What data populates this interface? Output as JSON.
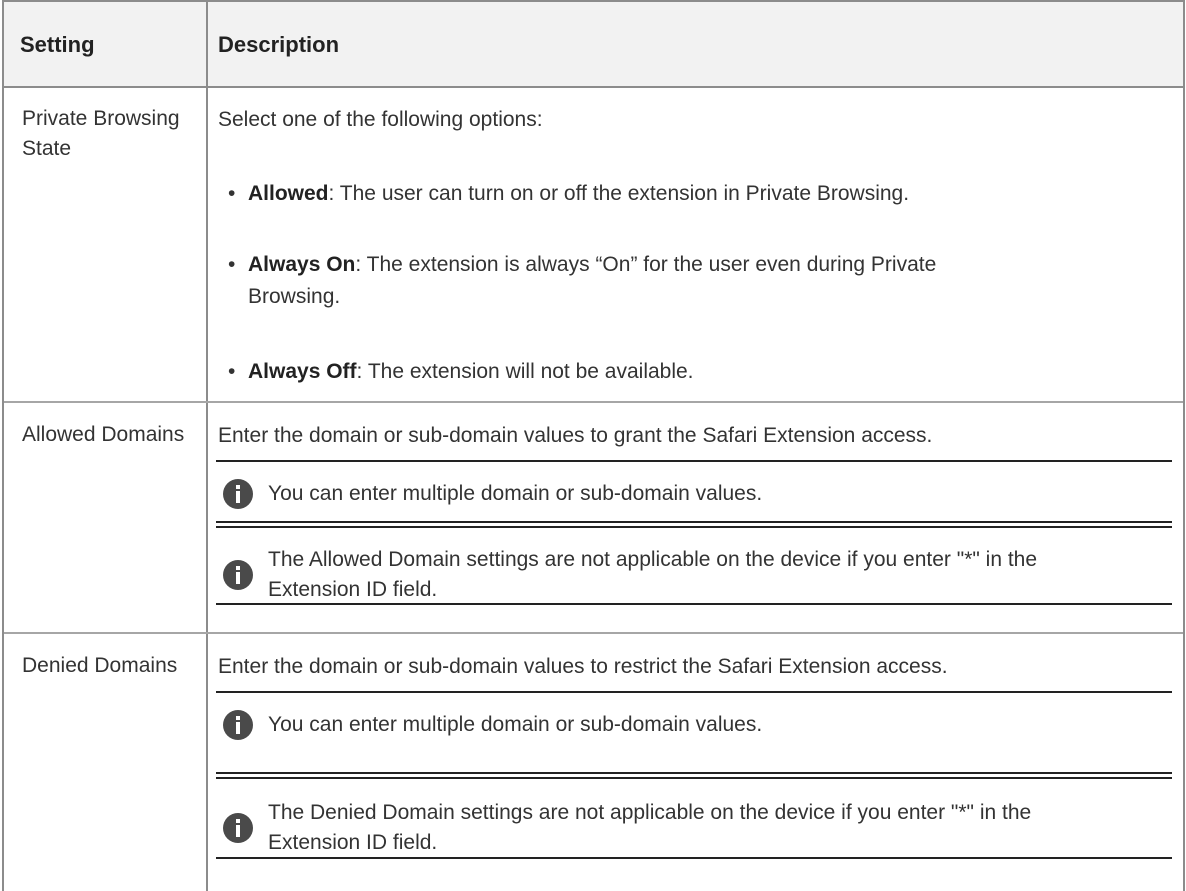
{
  "header": {
    "col1": "Setting",
    "col2": "Description"
  },
  "rows": [
    {
      "setting": "Private Browsing State",
      "intro": "Select one of the following options:",
      "options": [
        {
          "term": "Allowed",
          "desc": ": The user can turn on or off the extension in Private Browsing."
        },
        {
          "term": "Always On",
          "desc": ": The extension is always “On” for the user even during Private Browsing."
        },
        {
          "term": "Always Off",
          "desc": ": The extension will not be available."
        }
      ]
    },
    {
      "setting": "Allowed Domains",
      "intro": "Enter the domain or sub-domain values to grant the Safari Extension access.",
      "notes": [
        "You can enter multiple domain or sub-domain values.",
        "The Allowed Domain settings are not applicable on the device if you enter \"*\" in the Extension ID field."
      ]
    },
    {
      "setting": "Denied Domains",
      "intro": "Enter the domain or sub-domain values to restrict the Safari Extension access.",
      "notes": [
        "You can enter multiple domain or sub-domain values.",
        "The Denied Domain settings are not applicable on the device if you enter \"*\" in the Extension ID field."
      ]
    }
  ],
  "icons": {
    "note": "info-icon"
  },
  "colors": {
    "border": "#8c8c8c",
    "header_bg": "#f2f2f2",
    "text": "#333333",
    "icon": "#4a4a4a"
  }
}
